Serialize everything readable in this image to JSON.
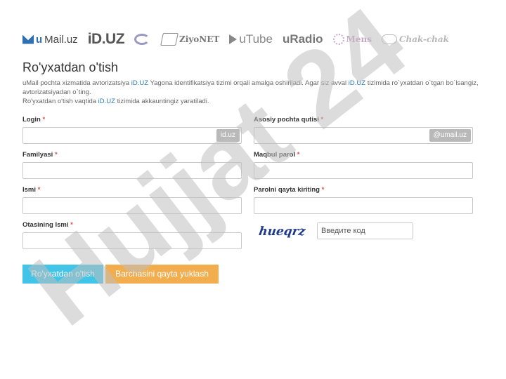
{
  "logos": {
    "umail": {
      "u": "u",
      "mail": "Mail.uz"
    },
    "iduz": "iD.UZ",
    "gov": "",
    "ziyonet": "ZiyoNET",
    "utube": "uTube",
    "uradio": "uRadio",
    "mens": "Mens",
    "chak": "Chak-chak"
  },
  "page": {
    "title": "Ro'yxatdan o'tish",
    "intro_line1_a": "uMail pochta xizmatida avtorizatsiya ",
    "intro_line1_link": "iD.UZ",
    "intro_line1_b": " Yagona identifikatsiya tizimi orqali amalga oshiriladi. Agar siz avval ",
    "intro_line1_link2": "iD.UZ",
    "intro_line1_c": " tizimida ro`yxatdan o`tgan bo`lsangiz, avtorizatsiyadan o`ting.",
    "intro_line2_a": "Ro'yxatdan o'tish vaqtida ",
    "intro_line2_link": "iD.UZ",
    "intro_line2_b": " tizimida akkauntingiz yaratiladi."
  },
  "form": {
    "required_mark": "*",
    "login": {
      "label": "Login",
      "value": "",
      "addon": "id.uz"
    },
    "mailbox": {
      "label": "Asosiy pochta qutisi",
      "value": "",
      "addon": "@umail.uz"
    },
    "surname": {
      "label": "Familyasi",
      "value": ""
    },
    "password": {
      "label": "Maqbul parol",
      "value": ""
    },
    "name": {
      "label": "Ismi",
      "value": ""
    },
    "password_repeat": {
      "label": "Parolni qayta kiriting",
      "value": ""
    },
    "patronymic": {
      "label": "Otasining Ismi",
      "value": ""
    },
    "captcha": {
      "image_text": "hueqrz",
      "placeholder": "Введите код",
      "value": ""
    }
  },
  "buttons": {
    "submit": "Ro'yxatdan o'tish",
    "reset": "Barchasini qayta yuklash"
  },
  "watermark": {
    "text": "Hujjat 24",
    "color": "#bfbfbf"
  },
  "colors": {
    "link": "#2a7ab0",
    "primary": "#41c4e8",
    "warning": "#f2ad4e",
    "required": "#d9534f"
  }
}
